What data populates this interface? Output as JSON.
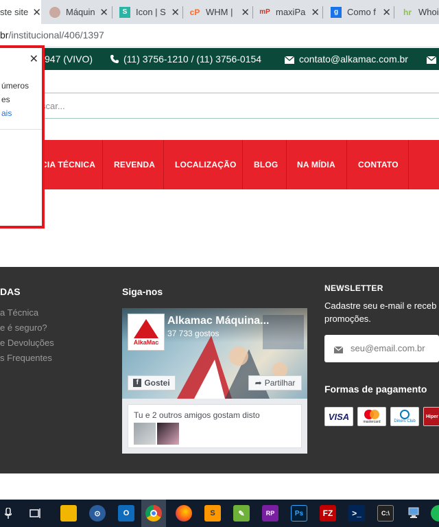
{
  "browser": {
    "tabs": [
      {
        "title": "ste site",
        "active": true,
        "favicon": "page-icon"
      },
      {
        "title": "Máquin",
        "favicon": "avatar-favicon"
      },
      {
        "title": "Icon | S",
        "favicon": "s-favicon"
      },
      {
        "title": "WHM |",
        "favicon": "cpanel-favicon"
      },
      {
        "title": "maxiPa",
        "favicon": "mp-favicon"
      },
      {
        "title": "Como f",
        "favicon": "g-favicon"
      },
      {
        "title": "Whois",
        "favicon": "hr-favicon"
      }
    ],
    "url_domain": "br",
    "url_path": "/institucional/406/1397"
  },
  "topbar": {
    "phone1": "947 (VIVO)",
    "phone2": "(11) 3756-1210 / (11) 3756-0154",
    "email": "contato@alkamac.com.br"
  },
  "search": {
    "placeholder": "scar..."
  },
  "nav": [
    "CIA TÉCNICA",
    "REVENDA",
    "LOCALIZAÇÃO",
    "BLOG",
    "NA MÍDIA",
    "CONTATO"
  ],
  "popup": {
    "close": "✕",
    "line1": "úmeros",
    "line2": "es",
    "line3": "ais"
  },
  "footer": {
    "col1": {
      "heading": "DAS",
      "links": [
        "a Técnica",
        "e é seguro?",
        "e Devoluções",
        "s Frequentes"
      ]
    },
    "col2": {
      "heading": "Siga-nos",
      "fb": {
        "page_name": "Alkamac Máquina...",
        "likes": "37 733 gostos",
        "like_btn": "Gostei",
        "share_btn": "Partilhar",
        "friends_text": "Tu e 2 outros amigos gostam disto",
        "logo_text": "AlkaMac"
      }
    },
    "col3": {
      "heading": "NEWSLETTER",
      "text_line1": "Cadastre seu e-mail e receb",
      "text_line2": "promoções.",
      "email_placeholder": "seu@email.com.br",
      "payment_heading": "Formas de pagamento",
      "cards": [
        "VISA",
        "mastercard",
        "Diners Club",
        "Hiper"
      ]
    }
  },
  "colors": {
    "topbar": "#0b4a3a",
    "nav": "#e8222b",
    "footer": "#333333",
    "popup_border": "#e5161d"
  }
}
